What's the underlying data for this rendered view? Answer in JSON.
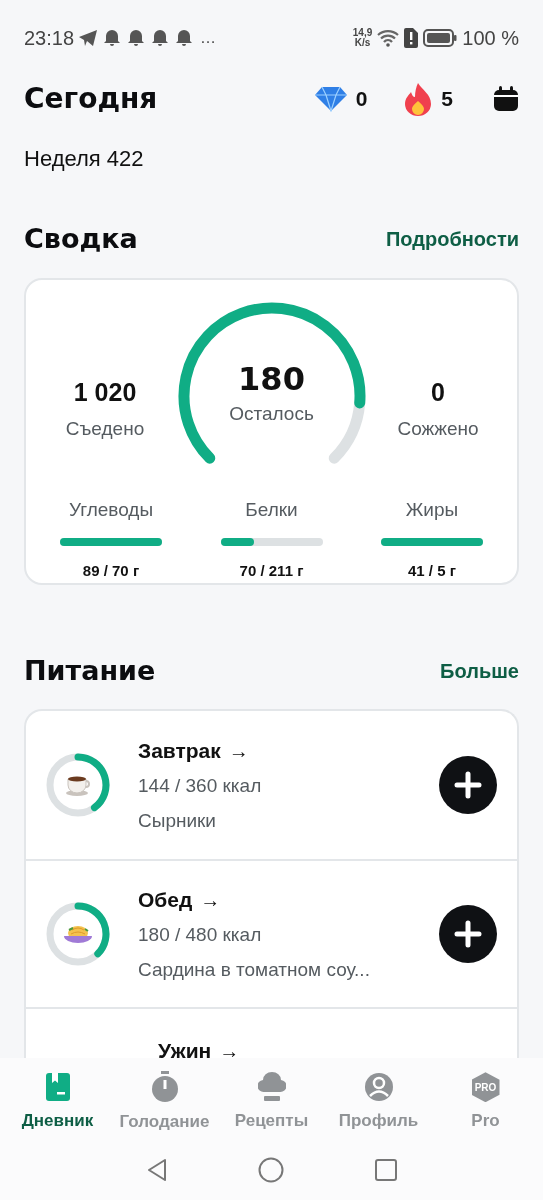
{
  "status_bar": {
    "time": "23:18",
    "more": "…",
    "speed_value": "14,9",
    "speed_unit": "K/s",
    "battery": "100 %"
  },
  "header": {
    "title": "Сегодня",
    "gems": "0",
    "streak": "5"
  },
  "week": "Неделя 422",
  "summary": {
    "title": "Сводка",
    "link": "Подробности",
    "eaten": {
      "value": "1 020",
      "label": "Съедено"
    },
    "remaining": {
      "value": "180",
      "label": "Осталось"
    },
    "burned": {
      "value": "0",
      "label": "Сожжено"
    },
    "macros": [
      {
        "name": "Углеводы",
        "level": 1,
        "amount": "89 / 70 г"
      },
      {
        "name": "Белки",
        "level": 0.33,
        "amount": "70 / 211 г"
      },
      {
        "name": "Жиры",
        "level": 1,
        "amount": "41 / 5 г"
      }
    ]
  },
  "nutrition": {
    "title": "Питание",
    "link": "Больше",
    "meals": [
      {
        "name": "Завтрак",
        "arrow": "→",
        "calories": "144 / 360 ккал",
        "foods": "Сырники"
      },
      {
        "name": "Обед",
        "arrow": "→",
        "calories": "180 / 480 ккал",
        "foods": "Сардина в томатном соу..."
      },
      {
        "name": "Ужин",
        "arrow": "→"
      }
    ]
  },
  "bottom_nav": [
    {
      "label": "Дневник",
      "selected": true
    },
    {
      "label": "Голодание",
      "selected": false
    },
    {
      "label": "Рецепты",
      "selected": false
    },
    {
      "label": "Профиль",
      "selected": false
    },
    {
      "label": "Pro",
      "badge": "PRO",
      "selected": false
    }
  ]
}
